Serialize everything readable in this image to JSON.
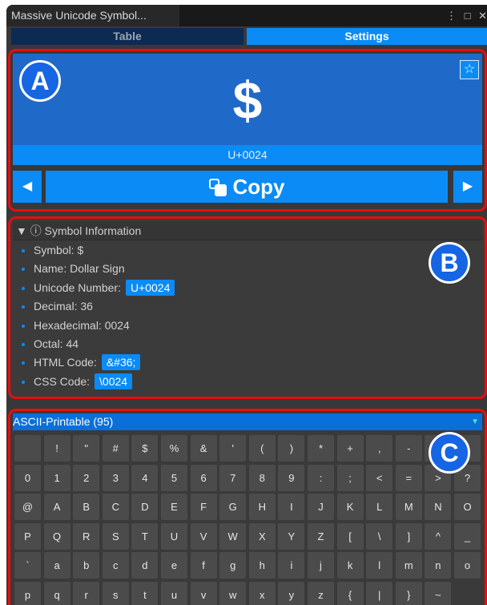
{
  "window": {
    "title": "Massive Unicode Symbol...",
    "controls": [
      "⋮",
      "□",
      "✕"
    ]
  },
  "tabs": [
    {
      "label": "Table",
      "active": false
    },
    {
      "label": "Settings",
      "active": true
    }
  ],
  "badges": {
    "a": "A",
    "b": "B",
    "c": "C"
  },
  "preview": {
    "symbol": "$",
    "star_icon": "☆",
    "code": "U+0024",
    "prev_arrow": "◀",
    "next_arrow": "▶",
    "copy_label": "Copy"
  },
  "info": {
    "header": "▼ ⓘ Symbol Information",
    "rows": [
      {
        "label": "Symbol:  $",
        "value": ""
      },
      {
        "label": "Name: Dollar Sign",
        "value": ""
      },
      {
        "label": "Unicode Number:",
        "value": "U+0024"
      },
      {
        "label": "Decimal: 36",
        "value": ""
      },
      {
        "label": "Hexadecimal: 0024",
        "value": ""
      },
      {
        "label": "Octal: 44",
        "value": ""
      },
      {
        "label": "HTML Code:",
        "value": "&#36;"
      },
      {
        "label": "CSS Code:",
        "value": "\\0024"
      }
    ]
  },
  "category": {
    "label": "ASCII-Printable (95)",
    "arrow": "▼"
  },
  "keys": [
    [
      " ",
      "!",
      "\"",
      "#",
      "$",
      "%",
      "&",
      "'",
      "(",
      ")",
      "*",
      "+",
      ",",
      "-",
      ".",
      "/"
    ],
    [
      "0",
      "1",
      "2",
      "3",
      "4",
      "5",
      "6",
      "7",
      "8",
      "9",
      ":",
      ";",
      "<",
      "=",
      ">",
      "?"
    ],
    [
      "@",
      "A",
      "B",
      "C",
      "D",
      "E",
      "F",
      "G",
      "H",
      "I",
      "J",
      "K",
      "L",
      "M",
      "N",
      "O"
    ],
    [
      "P",
      "Q",
      "R",
      "S",
      "T",
      "U",
      "V",
      "W",
      "X",
      "Y",
      "Z",
      "[",
      "\\",
      "]",
      "^",
      "_"
    ],
    [
      "`",
      "a",
      "b",
      "c",
      "d",
      "e",
      "f",
      "g",
      "h",
      "i",
      "j",
      "k",
      "l",
      "m",
      "n",
      "o"
    ],
    [
      "p",
      "q",
      "r",
      "s",
      "t",
      "u",
      "v",
      "w",
      "x",
      "y",
      "z",
      "{",
      "|",
      "}",
      "~"
    ]
  ],
  "colors": {
    "accent": "#0a8bf6",
    "outline": "#e80d10",
    "badge": "#1565e4",
    "panel": "#1f6ac8"
  }
}
